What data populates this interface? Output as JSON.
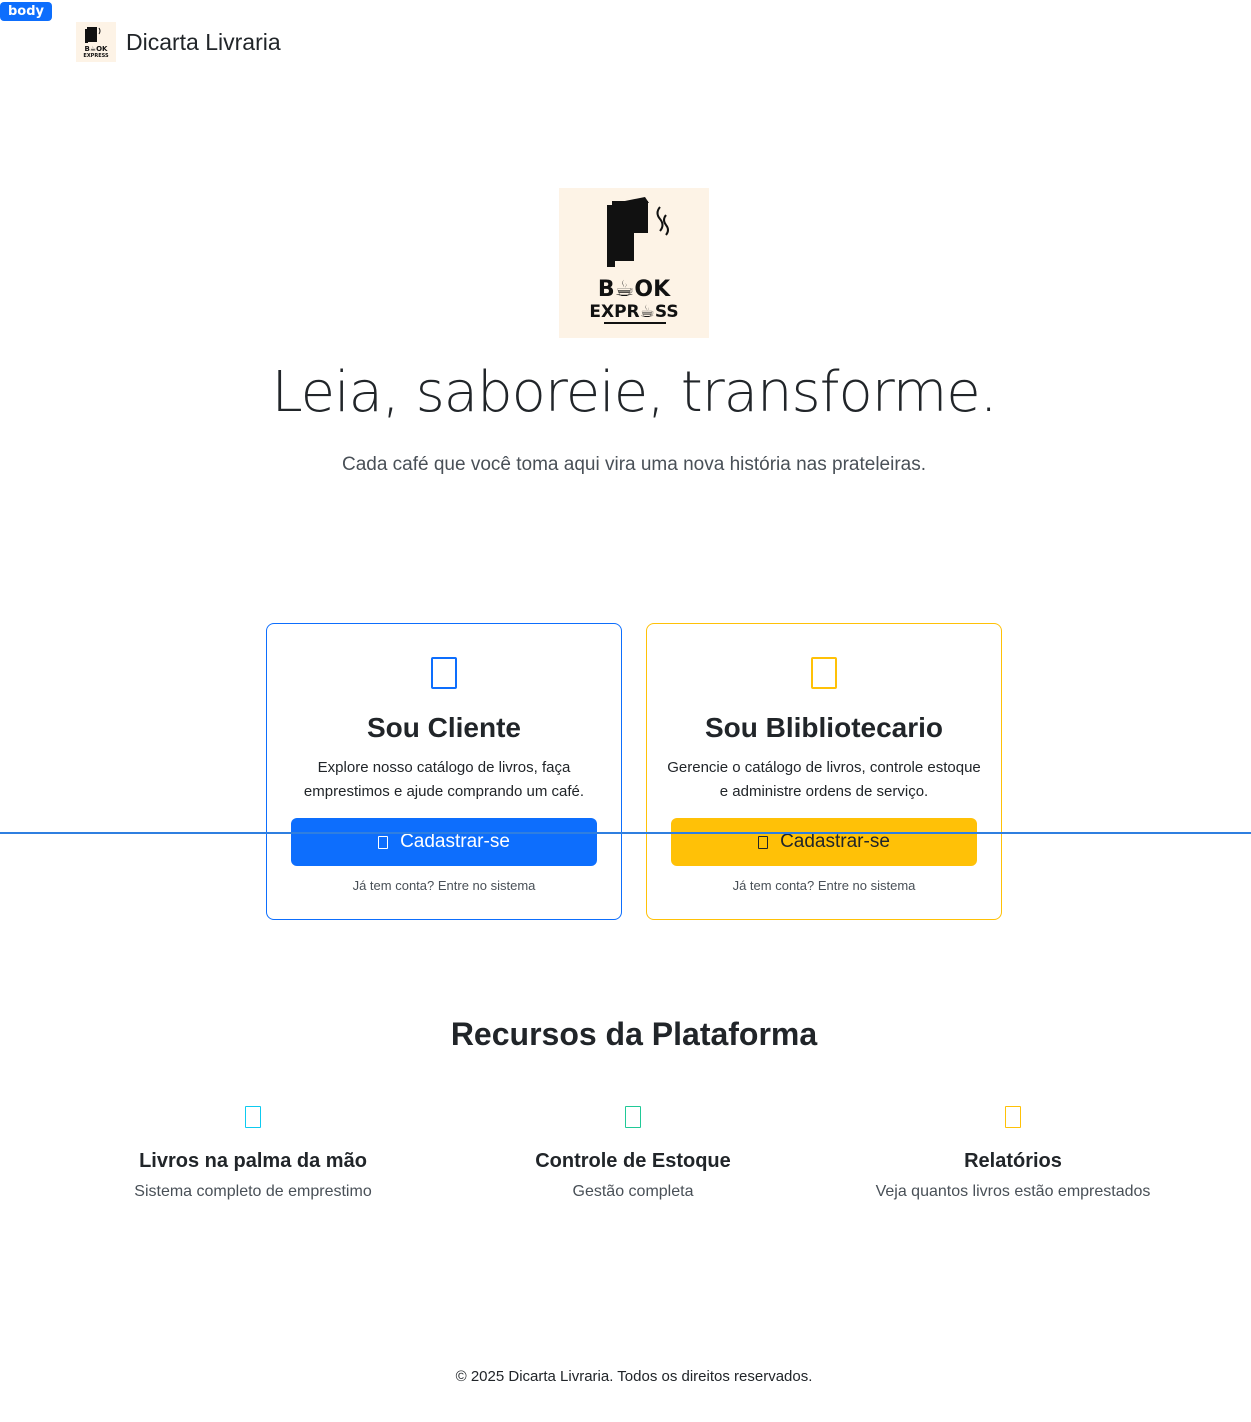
{
  "dev_badge": "body",
  "navbar": {
    "brand_name": "Dicarta Livraria",
    "logo_icon": "book-express-logo"
  },
  "hero": {
    "logo_icon": "book-express-logo",
    "title": "Leia, saboreie, transforme.",
    "subtitle": "Cada café que você toma aqui vira uma nova história nas prateleiras."
  },
  "cards": [
    {
      "title": "Sou Cliente",
      "text": "Explore nosso catálogo de livros, faça emprestimos e ajude comprando um café.",
      "button": "Cadastrar-se",
      "login": "Já tem conta? Entre no sistema",
      "icon": "user-icon",
      "color": "#0d6efd"
    },
    {
      "title": "Sou Blibliotecario",
      "text": "Gerencie o catálogo de livros, controle estoque e administre ordens de serviço.",
      "button": "Cadastrar-se",
      "login": "Já tem conta? Entre no sistema",
      "icon": "librarian-icon",
      "color": "#ffc107"
    }
  ],
  "features": {
    "title": "Recursos da Plataforma",
    "items": [
      {
        "title": "Livros na palma da mão",
        "desc": "Sistema completo de emprestimo",
        "icon": "book-icon",
        "color": "#0dcaf0"
      },
      {
        "title": "Controle de Estoque",
        "desc": "Gestão completa",
        "icon": "box-icon",
        "color": "#20c997"
      },
      {
        "title": "Relatórios",
        "desc": "Veja quantos livros estão emprestados",
        "icon": "chart-icon",
        "color": "#ffc107"
      }
    ]
  },
  "footer": "© 2025 Dicarta Livraria. Todos os direitos reservados."
}
